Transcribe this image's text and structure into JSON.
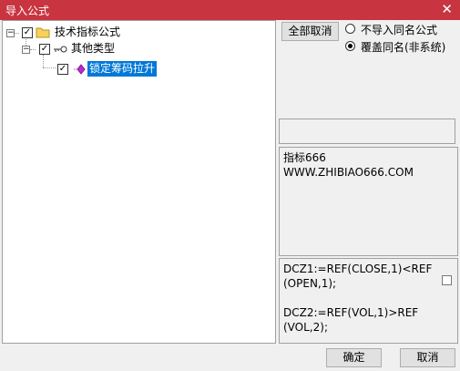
{
  "window": {
    "title": "导入公式",
    "close": "✕"
  },
  "tree": {
    "root": {
      "label": "技术指标公式",
      "expander": "−",
      "checked": "✓"
    },
    "group": {
      "label": "其他类型",
      "expander": "−",
      "checked": "✓"
    },
    "item": {
      "label": "锁定筹码拉升",
      "checked": "✓"
    }
  },
  "options": {
    "cancel_all": "全部取消",
    "radio_skip": "不导入同名公式",
    "radio_overwrite": "覆盖同名(非系统)"
  },
  "description": {
    "text": "指标666\nWWW.ZHIBIAO666.COM"
  },
  "code": {
    "text": "DCZ1:=REF(CLOSE,1)<REF\n(OPEN,1);\n\nDCZ2:=REF(VOL,1)>REF\n(VOL,2);"
  },
  "footer": {
    "ok": "确定",
    "cancel": "取消"
  }
}
